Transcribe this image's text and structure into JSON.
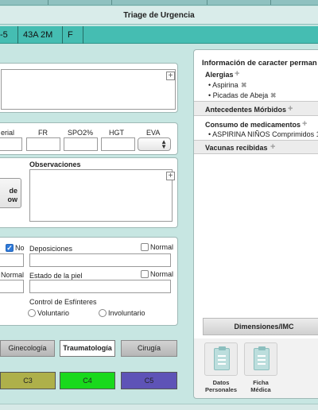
{
  "title": "Triage de Urgencia",
  "patient": {
    "id_fragment": "-5",
    "age": "43A 2M",
    "sex": "F"
  },
  "vitals": {
    "labels": {
      "arterial": "erial",
      "fr": "FR",
      "spo2": "SPO2%",
      "hgt": "HGT",
      "eva": "EVA"
    }
  },
  "side_button": {
    "line1": "de",
    "line2": "ow"
  },
  "observaciones": {
    "label": "Observaciones"
  },
  "exam": {
    "no_label": "No",
    "deposiciones_label": "Deposiciones",
    "normal_label": "Normal",
    "normal_left_label": "Normal",
    "piel_label": "Estado de la piel",
    "esfinteres_label": "Control de Esfínteres",
    "voluntario_label": "Voluntario",
    "involuntario_label": "Involuntario"
  },
  "specialties": {
    "ginecologia": "Ginecología",
    "traumatologia": "Traumatología",
    "cirugia": "Cirugía"
  },
  "categories": [
    {
      "label": "C3",
      "color": "#aeb04a"
    },
    {
      "label": "C4",
      "color": "#19d91c"
    },
    {
      "label": "C5",
      "color": "#5e53b7"
    }
  ],
  "right_panel": {
    "header": "Información de caracter perman",
    "allergies_label": "Alergias",
    "allergies": [
      "Aspirina",
      "Picadas de Abeja"
    ],
    "antecedentes_label": "Antecedentes Mórbidos",
    "medicamentos_label": "Consumo de medicamentos",
    "medicamentos": [
      "ASPIRINA NIÑOS Comprimidos 1"
    ],
    "vacunas_label": "Vacunas recibidas",
    "dimensiones_label": "Dimensiones/IMC"
  },
  "icons": [
    {
      "name": "datos-personales",
      "line1": "Datos",
      "line2": "Personales"
    },
    {
      "name": "ficha-medica",
      "line1": "Ficha",
      "line2": "Médica"
    }
  ]
}
